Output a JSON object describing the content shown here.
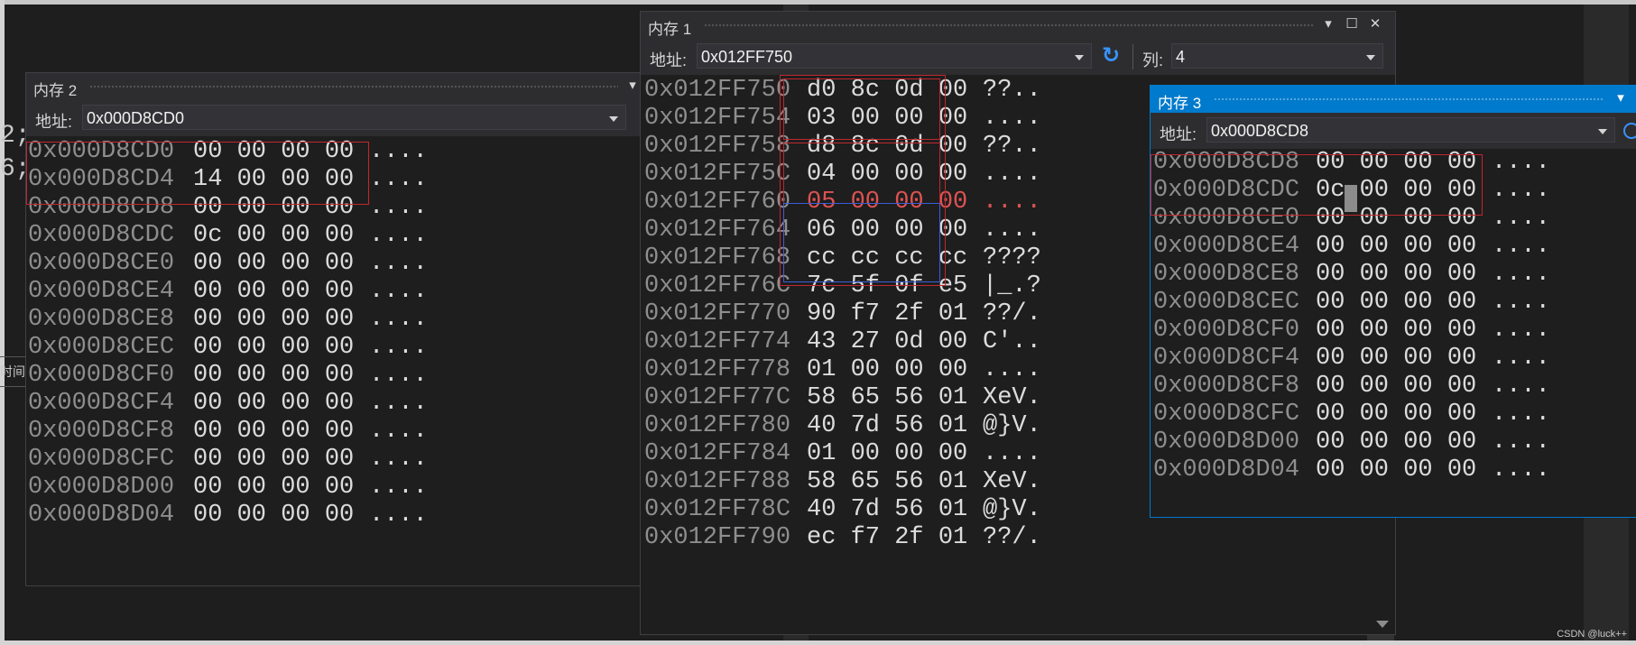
{
  "colors": {
    "background": "#1e1e1e",
    "panel_title": "#2d2d30",
    "active_title": "#007acc",
    "address_text": "#8e8e8e",
    "hex_text": "#dcdcdc",
    "highlight_red": "#c0272d",
    "highlight_blue": "#3a5ed8",
    "changed_value": "#e05252"
  },
  "code_fragments": [
    "2;",
    "6;"
  ],
  "time_fragment": "时间",
  "watermark": "CSDN @luck++",
  "memory1": {
    "title": "内存 1",
    "address_label": "地址:",
    "address_value": "0x012FF750",
    "columns_label": "列:",
    "columns_value": "4",
    "icons": {
      "dropdown": "dropdown-icon",
      "maximize": "maximize-icon",
      "close": "close-icon",
      "refresh": "refresh-icon"
    },
    "rows": [
      {
        "addr": "0x012FF750",
        "hex": "d0 8c 0d 00",
        "ascii": "??.."
      },
      {
        "addr": "0x012FF754",
        "hex": "03 00 00 00",
        "ascii": "...."
      },
      {
        "addr": "0x012FF758",
        "hex": "d8 8c 0d 00",
        "ascii": "??.."
      },
      {
        "addr": "0x012FF75C",
        "hex": "04 00 00 00",
        "ascii": "...."
      },
      {
        "addr": "0x012FF760",
        "hex": "05 00 00 00",
        "ascii": "....",
        "changed": true
      },
      {
        "addr": "0x012FF764",
        "hex": "06 00 00 00",
        "ascii": "...."
      },
      {
        "addr": "0x012FF768",
        "hex": "cc cc cc cc",
        "ascii": "????"
      },
      {
        "addr": "0x012FF76C",
        "hex": "7c 5f 0f e5",
        "ascii": "|_.?"
      },
      {
        "addr": "0x012FF770",
        "hex": "90 f7 2f 01",
        "ascii": "??/."
      },
      {
        "addr": "0x012FF774",
        "hex": "43 27 0d 00",
        "ascii": "C'.."
      },
      {
        "addr": "0x012FF778",
        "hex": "01 00 00 00",
        "ascii": "...."
      },
      {
        "addr": "0x012FF77C",
        "hex": "58 65 56 01",
        "ascii": "XeV."
      },
      {
        "addr": "0x012FF780",
        "hex": "40 7d 56 01",
        "ascii": "@}V."
      },
      {
        "addr": "0x012FF784",
        "hex": "01 00 00 00",
        "ascii": "...."
      },
      {
        "addr": "0x012FF788",
        "hex": "58 65 56 01",
        "ascii": "XeV."
      },
      {
        "addr": "0x012FF78C",
        "hex": "40 7d 56 01",
        "ascii": "@}V."
      },
      {
        "addr": "0x012FF790",
        "hex": "ec f7 2f 01",
        "ascii": "??/."
      }
    ]
  },
  "memory2": {
    "title": "内存 2",
    "address_label": "地址:",
    "address_value": "0x000D8CD0",
    "rows": [
      {
        "addr": "0x000D8CD0",
        "hex": "00 00 00 00",
        "ascii": "...."
      },
      {
        "addr": "0x000D8CD4",
        "hex": "14 00 00 00",
        "ascii": "...."
      },
      {
        "addr": "0x000D8CD8",
        "hex": "00 00 00 00",
        "ascii": "...."
      },
      {
        "addr": "0x000D8CDC",
        "hex": "0c 00 00 00",
        "ascii": "...."
      },
      {
        "addr": "0x000D8CE0",
        "hex": "00 00 00 00",
        "ascii": "...."
      },
      {
        "addr": "0x000D8CE4",
        "hex": "00 00 00 00",
        "ascii": "...."
      },
      {
        "addr": "0x000D8CE8",
        "hex": "00 00 00 00",
        "ascii": "...."
      },
      {
        "addr": "0x000D8CEC",
        "hex": "00 00 00 00",
        "ascii": "...."
      },
      {
        "addr": "0x000D8CF0",
        "hex": "00 00 00 00",
        "ascii": "...."
      },
      {
        "addr": "0x000D8CF4",
        "hex": "00 00 00 00",
        "ascii": "...."
      },
      {
        "addr": "0x000D8CF8",
        "hex": "00 00 00 00",
        "ascii": "...."
      },
      {
        "addr": "0x000D8CFC",
        "hex": "00 00 00 00",
        "ascii": "...."
      },
      {
        "addr": "0x000D8D00",
        "hex": "00 00 00 00",
        "ascii": "...."
      },
      {
        "addr": "0x000D8D04",
        "hex": "00 00 00 00",
        "ascii": "...."
      }
    ]
  },
  "memory3": {
    "title": "内存 3",
    "address_label": "地址:",
    "address_value": "0x000D8CD8",
    "rows": [
      {
        "addr": "0x000D8CD8",
        "hex": "00 00 00 00",
        "ascii": "...."
      },
      {
        "addr": "0x000D8CDC",
        "hex": "0c 00 00 00",
        "ascii": "...."
      },
      {
        "addr": "0x000D8CE0",
        "hex": "00 00 00 00",
        "ascii": "...."
      },
      {
        "addr": "0x000D8CE4",
        "hex": "00 00 00 00",
        "ascii": "...."
      },
      {
        "addr": "0x000D8CE8",
        "hex": "00 00 00 00",
        "ascii": "...."
      },
      {
        "addr": "0x000D8CEC",
        "hex": "00 00 00 00",
        "ascii": "...."
      },
      {
        "addr": "0x000D8CF0",
        "hex": "00 00 00 00",
        "ascii": "...."
      },
      {
        "addr": "0x000D8CF4",
        "hex": "00 00 00 00",
        "ascii": "...."
      },
      {
        "addr": "0x000D8CF8",
        "hex": "00 00 00 00",
        "ascii": "...."
      },
      {
        "addr": "0x000D8CFC",
        "hex": "00 00 00 00",
        "ascii": "...."
      },
      {
        "addr": "0x000D8D00",
        "hex": "00 00 00 00",
        "ascii": "...."
      },
      {
        "addr": "0x000D8D04",
        "hex": "00 00 00 00",
        "ascii": "...."
      }
    ]
  }
}
